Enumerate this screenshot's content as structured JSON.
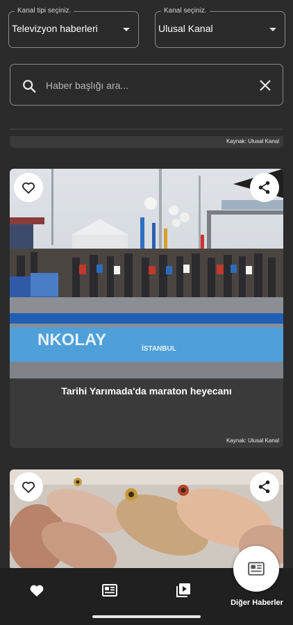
{
  "filters": {
    "type": {
      "label": "Kanal tipi seçiniz.",
      "value": "Televizyon haberleri"
    },
    "channel": {
      "label": "Kanal seçiniz.",
      "value": "Ulusal Kanal"
    }
  },
  "search": {
    "placeholder": "Haber başlığı ara..."
  },
  "previous_card": {
    "source": "Kaynak: Ulusal Kanal"
  },
  "news": [
    {
      "title": "Tarihi Yarımada'da maraton heyecanı",
      "source": "Kaynak: Ulusal Kanal",
      "banner_text": "NKOLAY",
      "banner_sub": "İSTANBUL"
    },
    {
      "title": "",
      "source": ""
    }
  ],
  "bottom_nav": {
    "items": [
      {
        "icon": "heart-icon"
      },
      {
        "icon": "newspaper-icon"
      },
      {
        "icon": "video-library-icon"
      }
    ],
    "fab_label": "Diğer Haberler"
  },
  "colors": {
    "background": "#2b2b2b",
    "card": "#3a3a3a",
    "nav": "#202020",
    "border": "#8a8a8a"
  }
}
